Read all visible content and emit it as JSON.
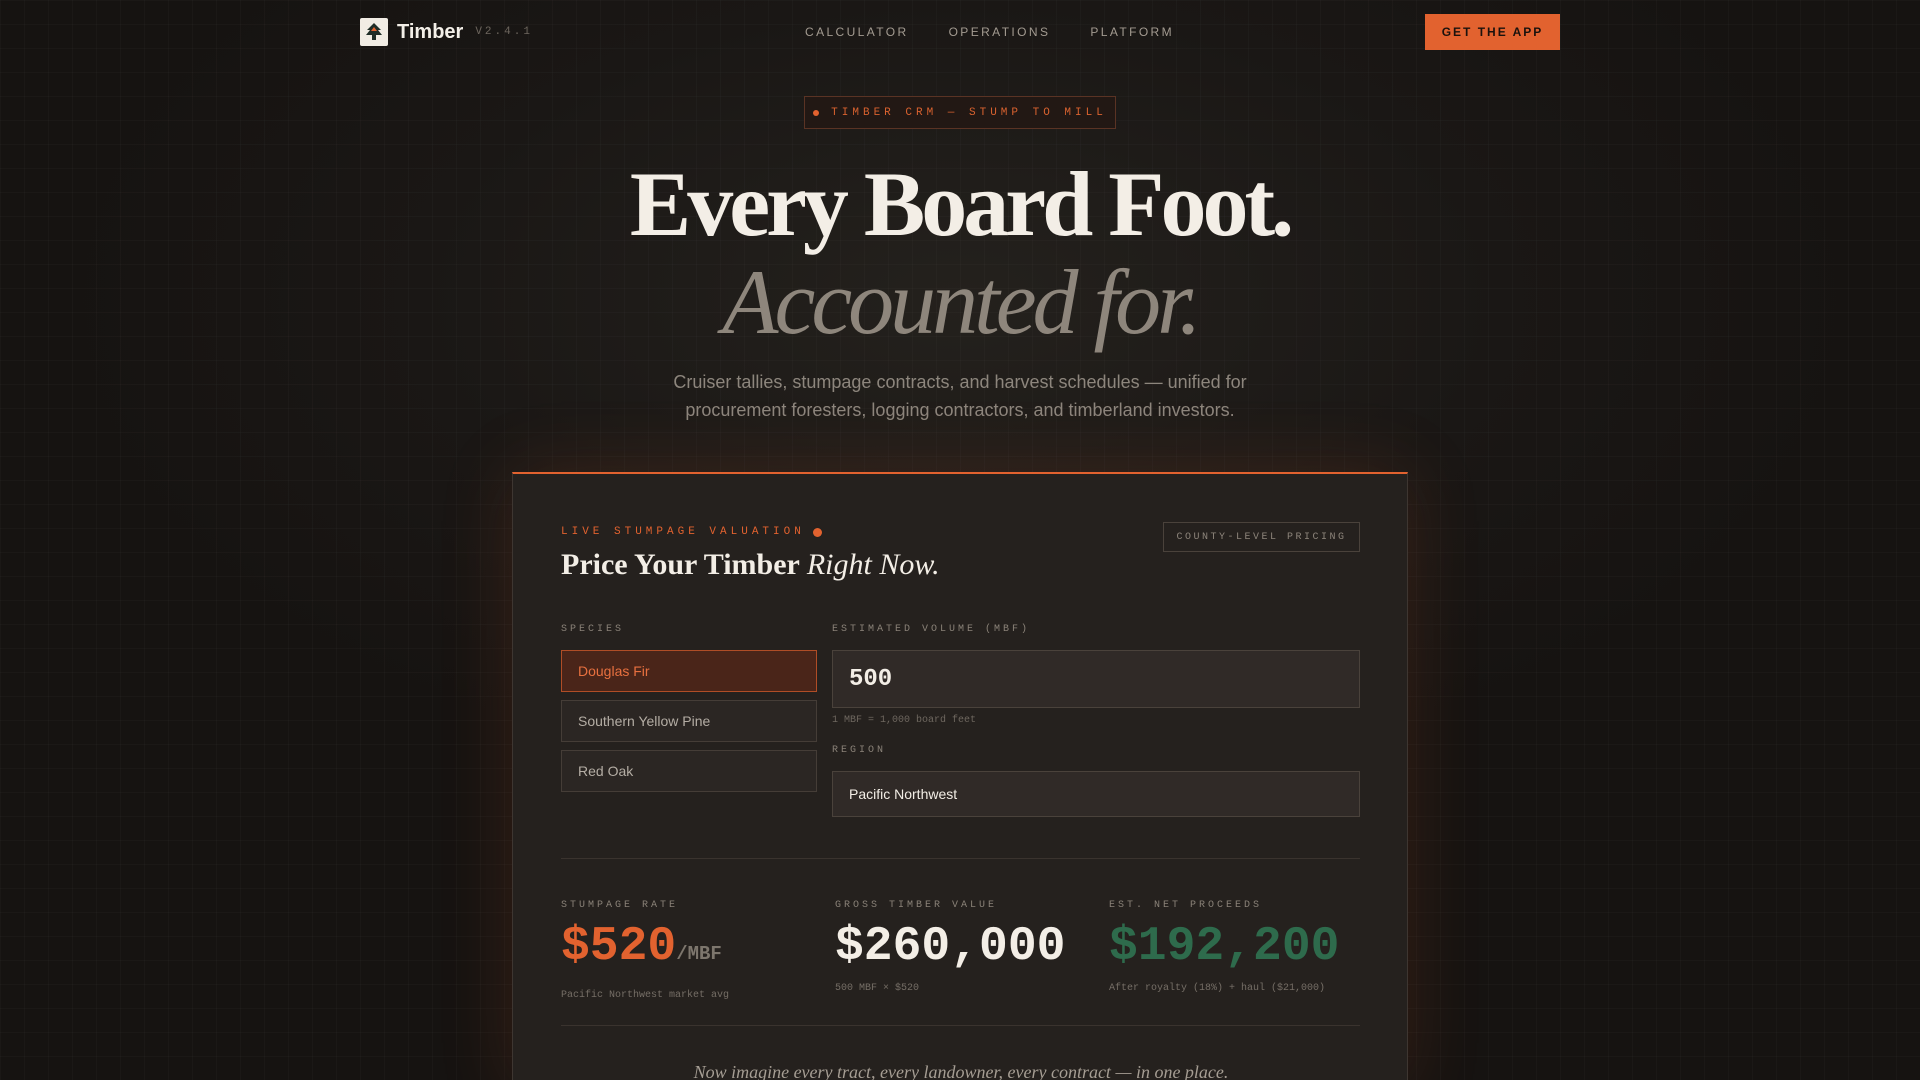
{
  "nav": {
    "brand": "Timber",
    "version": "V2.4.1",
    "links": [
      "CALCULATOR",
      "OPERATIONS",
      "PLATFORM"
    ],
    "cta": "GET THE APP"
  },
  "hero": {
    "pill": "TIMBER CRM — STUMP TO MILL",
    "title_line1": "Every Board Foot.",
    "title_line2": "Accounted for.",
    "subtitle": "Cruiser tallies, stumpage contracts, and harvest schedules — unified for procurement foresters, logging contractors, and timberland investors."
  },
  "calculator": {
    "kicker": "LIVE STUMPAGE VALUATION",
    "title_main": "Price Your Timber ",
    "title_em": "Right Now.",
    "badge": "COUNTY-LEVEL PRICING",
    "species_label": "SPECIES",
    "species": [
      "Douglas Fir",
      "Southern Yellow Pine",
      "Red Oak"
    ],
    "selected_species": "Douglas Fir",
    "volume_label": "ESTIMATED VOLUME (MBF)",
    "volume_value": "500",
    "volume_hint": "1 MBF = 1,000 board feet",
    "region_label": "REGION",
    "region_value": "Pacific Northwest",
    "stats": [
      {
        "label": "STUMPAGE RATE",
        "value": "$520",
        "unit": "/MBF",
        "note": "Pacific Northwest market avg",
        "color": "#e2622f"
      },
      {
        "label": "GROSS TIMBER VALUE",
        "value": "$260,000",
        "unit": "",
        "note": "500 MBF × $520",
        "color": "#f3eee6"
      },
      {
        "label": "EST. NET PROCEEDS",
        "value": "$192,200",
        "unit": "",
        "note": "After royalty (18%) + haul ($21,000)",
        "color": "#2e6b4c"
      }
    ],
    "closing": "Now imagine every tract, every landowner, every contract — in one place."
  },
  "colors": {
    "accent": "#e2622f",
    "positive": "#2e6b4c",
    "background": "#171412"
  },
  "icons": {
    "logo": "tree-logo-icon"
  }
}
